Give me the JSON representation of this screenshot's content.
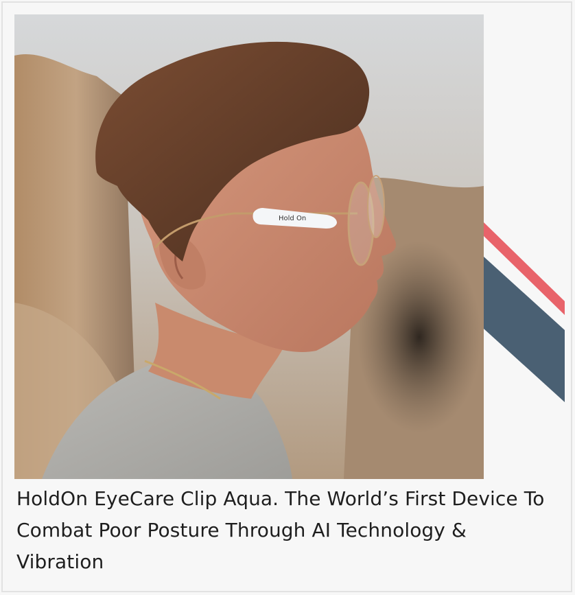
{
  "product": {
    "caption": "HoldOn EyeCare Clip Aqua. The World’s First Device To Combat Poor Posture Through AI Technology & Vibration",
    "clip_brand": "Hold On",
    "image_alt": "Man in profile wearing round glasses with a HoldOn clip attached to the temple arm"
  },
  "colors": {
    "stripe_red": "#e8636a",
    "stripe_navy": "#4a6073",
    "background": "#f7f7f7",
    "text": "#1e1e1e"
  }
}
